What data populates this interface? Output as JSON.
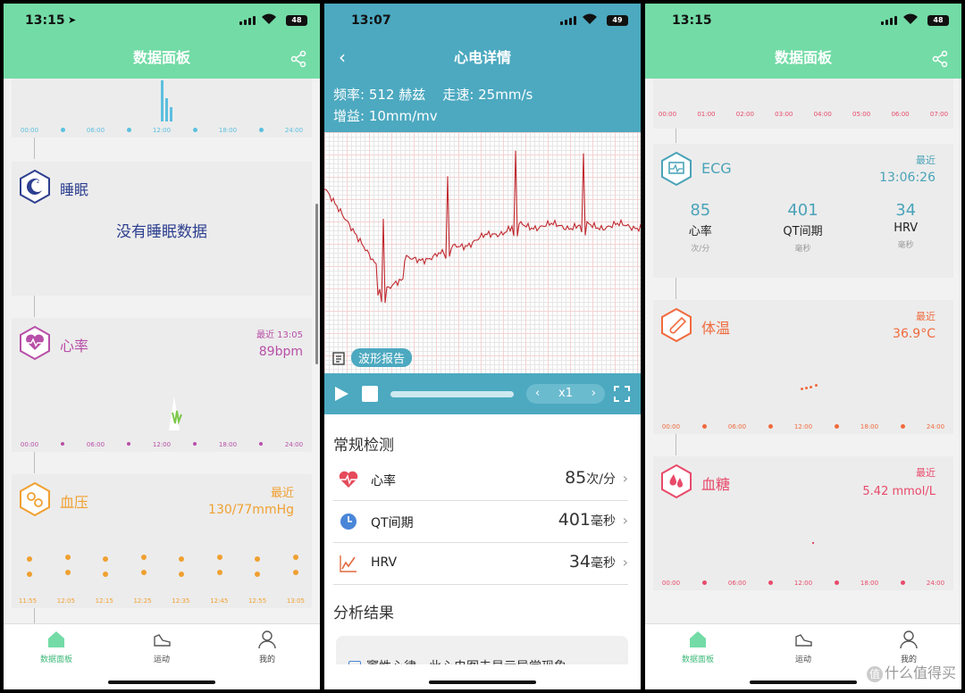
{
  "screens": {
    "left": {
      "status_time": "13:15",
      "battery": "48",
      "title": "数据面板",
      "top_axis": [
        "00:00",
        "06:00",
        "12:00",
        "18:00",
        "24:00"
      ],
      "sleep": {
        "title": "睡眠",
        "empty": "没有睡眠数据"
      },
      "heart": {
        "title": "心率",
        "latest_label": "最近 13:05",
        "value": "89bpm",
        "axis": [
          "00:00",
          "06:00",
          "12:00",
          "18:00",
          "24:00"
        ]
      },
      "bp": {
        "title": "血压",
        "latest_label": "最近",
        "value": "130/77mmHg",
        "axis": [
          "11:55",
          "12:05",
          "12:15",
          "12:25",
          "12:35",
          "12:45",
          "12:55",
          "13:05"
        ]
      },
      "tabs": [
        "数据面板",
        "运动",
        "我的"
      ]
    },
    "middle": {
      "status_time": "13:07",
      "battery": "49",
      "title": "心电详情",
      "freq": "频率: 512 赫兹",
      "speed": "走速: 25mm/s",
      "gain": "增益: 10mm/mv",
      "report_label": "波形报告",
      "speed_control": "x1",
      "routine_title": "常规检测",
      "rows": [
        {
          "label": "心率",
          "value": "85",
          "unit": "次/分"
        },
        {
          "label": "QT间期",
          "value": "401",
          "unit": "毫秒"
        },
        {
          "label": "HRV",
          "value": "34",
          "unit": "毫秒"
        }
      ],
      "analysis_title": "分析结果",
      "analysis_text": "窦性心律，此心电图未显示异常现象"
    },
    "right": {
      "status_time": "13:15",
      "battery": "48",
      "title": "数据面板",
      "top_axis": [
        "00:00",
        "01:00",
        "02:00",
        "03:00",
        "04:00",
        "05:00",
        "06:00",
        "07:00"
      ],
      "ecg": {
        "title": "ECG",
        "latest_label": "最近",
        "latest_time": "13:06:26",
        "metrics": [
          {
            "value": "85",
            "name": "心率",
            "unit": "次/分"
          },
          {
            "value": "401",
            "name": "QT间期",
            "unit": "毫秒"
          },
          {
            "value": "34",
            "name": "HRV",
            "unit": "毫秒"
          }
        ]
      },
      "temp": {
        "title": "体温",
        "latest_label": "最近",
        "value": "36.9°C",
        "axis": [
          "00:00",
          "06:00",
          "12:00",
          "18:00",
          "24:00"
        ]
      },
      "glucose": {
        "title": "血糖",
        "latest_label": "最近",
        "value": "5.42 mmol/L",
        "axis": [
          "00:00",
          "06:00",
          "12:00",
          "18:00",
          "24:00"
        ]
      },
      "tabs": [
        "数据面板",
        "运动",
        "我的"
      ]
    }
  },
  "watermark": "什么值得买",
  "colors": {
    "green": "#73dba6",
    "teal": "#4ca9c0",
    "sleep": "#2d3f8f",
    "heart": "#b84fa8",
    "bp": "#f0a030",
    "ecg": "#4aa3b8",
    "temp": "#f06a3c",
    "glucose": "#e84a6a"
  }
}
